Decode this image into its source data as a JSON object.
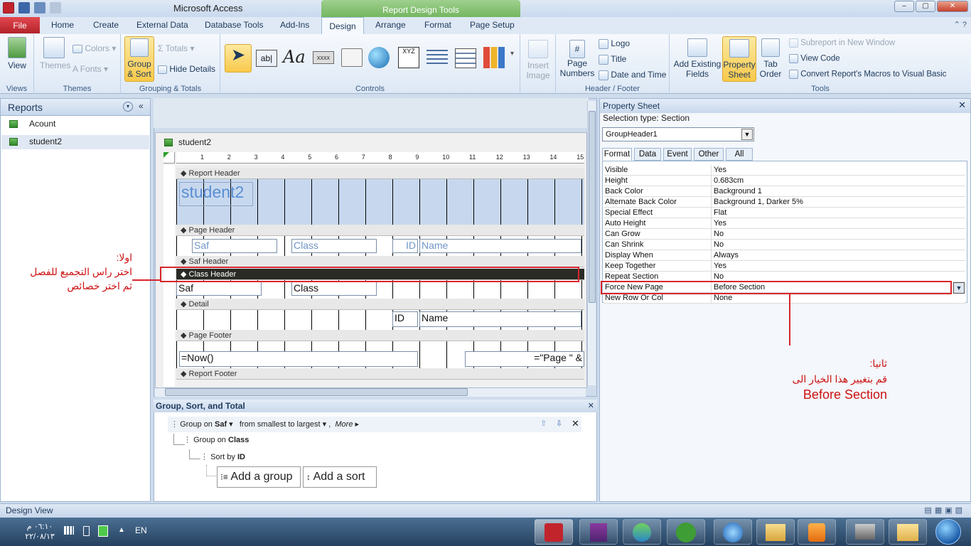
{
  "titlebar": {
    "app_title": "Microsoft Access",
    "context_tools": "Report Design Tools"
  },
  "tabs": {
    "file": "File",
    "home": "Home",
    "create": "Create",
    "external": "External Data",
    "dbtools": "Database Tools",
    "addins": "Add-Ins",
    "design": "Design",
    "arrange": "Arrange",
    "format": "Format",
    "pagesetup": "Page Setup"
  },
  "ribbon": {
    "views": {
      "label": "Views",
      "view": "View"
    },
    "themes": {
      "label": "Themes",
      "themes": "Themes",
      "colors": "Colors",
      "fonts": "Fonts"
    },
    "grouping": {
      "label": "Grouping & Totals",
      "group_sort_1": "Group",
      "group_sort_2": "& Sort",
      "totals": "Totals",
      "hide_details": "Hide Details"
    },
    "controls": {
      "label": "Controls",
      "insert_image_1": "Insert",
      "insert_image_2": "Image",
      "textbox": "ab|",
      "label_ctl": "Aa",
      "xyz": "XYZ",
      "xxxx": "xxxx"
    },
    "header_footer": {
      "label": "Header / Footer",
      "page_numbers_1": "Page",
      "page_numbers_2": "Numbers",
      "logo": "Logo",
      "title": "Title",
      "date_time": "Date and Time"
    },
    "tools": {
      "label": "Tools",
      "add_fields_1": "Add Existing",
      "add_fields_2": "Fields",
      "property_sheet_1": "Property",
      "property_sheet_2": "Sheet",
      "tab_order_1": "Tab",
      "tab_order_2": "Order",
      "subreport": "Subreport in New Window",
      "view_code": "View Code",
      "convert": "Convert Report's Macros to Visual Basic"
    }
  },
  "nav": {
    "title": "Reports",
    "items": [
      "Acount",
      "student2"
    ]
  },
  "doc": {
    "tab": "student2",
    "sections": {
      "report_header": "Report Header",
      "page_header": "Page Header",
      "saf_header": "Saf Header",
      "class_header": "Class Header",
      "detail": "Detail",
      "page_footer": "Page Footer",
      "report_footer": "Report Footer"
    },
    "controls": {
      "title": "student2",
      "saf_lbl": "Saf",
      "class_lbl": "Class",
      "id_lbl": "ID",
      "name_lbl": "Name",
      "saf": "Saf",
      "class": "Class",
      "id": "ID",
      "name": "Name",
      "now": "=Now()",
      "page": "=\"Page \" &"
    },
    "ruler": [
      "1",
      "2",
      "3",
      "4",
      "5",
      "6",
      "7",
      "8",
      "9",
      "10",
      "11",
      "12",
      "13",
      "14",
      "15"
    ]
  },
  "props": {
    "title": "Property Sheet",
    "selection_type": "Selection type:  Section",
    "selected": "GroupHeader1",
    "tabs": [
      "Format",
      "Data",
      "Event",
      "Other",
      "All"
    ],
    "rows": [
      [
        "Visible",
        "Yes"
      ],
      [
        "Height",
        "0.683cm"
      ],
      [
        "Back Color",
        "Background 1"
      ],
      [
        "Alternate Back Color",
        "Background 1, Darker 5%"
      ],
      [
        "Special Effect",
        "Flat"
      ],
      [
        "Auto Height",
        "Yes"
      ],
      [
        "Can Grow",
        "No"
      ],
      [
        "Can Shrink",
        "No"
      ],
      [
        "Display When",
        "Always"
      ],
      [
        "Keep Together",
        "Yes"
      ],
      [
        "Repeat Section",
        "No"
      ],
      [
        "Force New Page",
        "Before Section"
      ],
      [
        "New Row Or Col",
        "None"
      ]
    ]
  },
  "groupsort": {
    "title": "Group, Sort, and Total",
    "group_on": "Group on",
    "saf": "Saf",
    "order": "from smallest to largest",
    "more": "More",
    "group_on2": "Group on",
    "class": "Class",
    "sort_by": "Sort by",
    "id": "ID",
    "add_group": "Add a group",
    "add_sort": "Add a sort"
  },
  "status": {
    "text": "Design View"
  },
  "taskbar": {
    "time": "٠٦:١٠ م",
    "date": "٢٢/٠٨/١٣",
    "lang": "EN"
  },
  "annotations": {
    "first_1": "اولا:",
    "first_2": "اختر راس التجميع للفصل",
    "first_3": "ثم اختر خصائص",
    "second_1": "ثانيا:",
    "second_2": "قم بتغيير هذا الخيار الى",
    "second_3": "Before Section"
  }
}
